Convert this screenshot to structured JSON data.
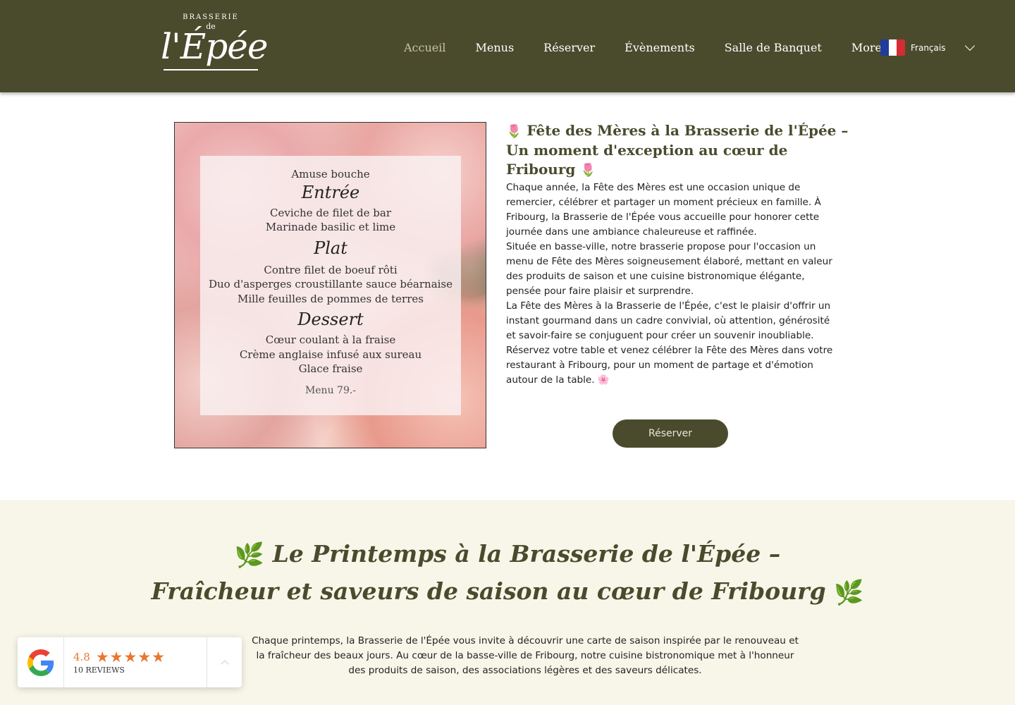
{
  "header": {
    "logo": {
      "top": "BRASSERIE",
      "de": "de",
      "main": "l'Épée"
    },
    "nav": [
      {
        "label": "Accueil",
        "active": true
      },
      {
        "label": "Menus",
        "active": false
      },
      {
        "label": "Réserver",
        "active": false
      },
      {
        "label": "Évènements",
        "active": false
      },
      {
        "label": "Salle de Banquet",
        "active": false
      },
      {
        "label": "More",
        "active": false
      }
    ],
    "language": {
      "label": "Français",
      "flag_colors": [
        "#1f3d9a",
        "#ffffff",
        "#d52b33"
      ]
    }
  },
  "menu_card": {
    "amuse": "Amuse bouche",
    "entree_head": "Entrée",
    "entree_1": "Ceviche de filet de bar",
    "entree_2": "Marinade basilic et lime",
    "plat_head": "Plat",
    "plat_1": "Contre filet de boeuf rôti",
    "plat_2": "Duo d'asperges croustillante sauce béarnaise",
    "plat_3": "Mille feuilles de pommes de terres",
    "dessert_head": "Dessert",
    "dessert_1": "Cœur coulant à la fraise",
    "dessert_2": "Crème anglaise infusé aux sureau",
    "dessert_3": "Glace fraise",
    "price": "Menu 79.-"
  },
  "event": {
    "title": "Fête des Mères à la Brasserie de l'Épée – Un moment d'exception au cœur de Fribourg",
    "title_emoji": "🌷",
    "paragraphs": [
      "Chaque année, la Fête des Mères est une occasion unique de remercier, célébrer et partager un moment précieux en famille. À Fribourg, la Brasserie de l'Épée vous accueille pour honorer cette journée dans une ambiance chaleureuse et raffinée.",
      "Située en basse-ville, notre brasserie propose pour l'occasion un menu de Fête des Mères soigneusement élaboré, mettant en valeur des produits de saison et une cuisine bistronomique élégante, pensée pour faire plaisir et surprendre.",
      "La Fête des Mères à la Brasserie de l'Épée, c'est le plaisir d'offrir un instant gourmand dans un cadre convivial, où attention, générosité et savoir-faire se conjuguent pour créer un souvenir inoubliable.",
      "Réservez votre table et venez célébrer la Fête des Mères dans votre restaurant à Fribourg, pour un moment de partage et d'émotion autour de la table. 🌸"
    ],
    "button_label": "Réserver"
  },
  "spring": {
    "title_line1": "Le Printemps à la Brasserie de l'Épée –",
    "title_line2": "Fraîcheur et saveurs de saison au cœur de Fribourg",
    "leaf_icon": "🌿",
    "body": "Chaque printemps, la Brasserie de l'Épée vous invite à découvrir une carte de saison inspirée par le renouveau et la fraîcheur des beaux jours. Au cœur de la basse-ville de Fribourg, notre cuisine bistronomique met à l'honneur des produits de saison, des associations légères et des saveurs délicates."
  },
  "review_widget": {
    "rating": "4.8",
    "stars": "★★★★★",
    "count_label": "10 REVIEWS",
    "star_color": "#e8772e"
  }
}
